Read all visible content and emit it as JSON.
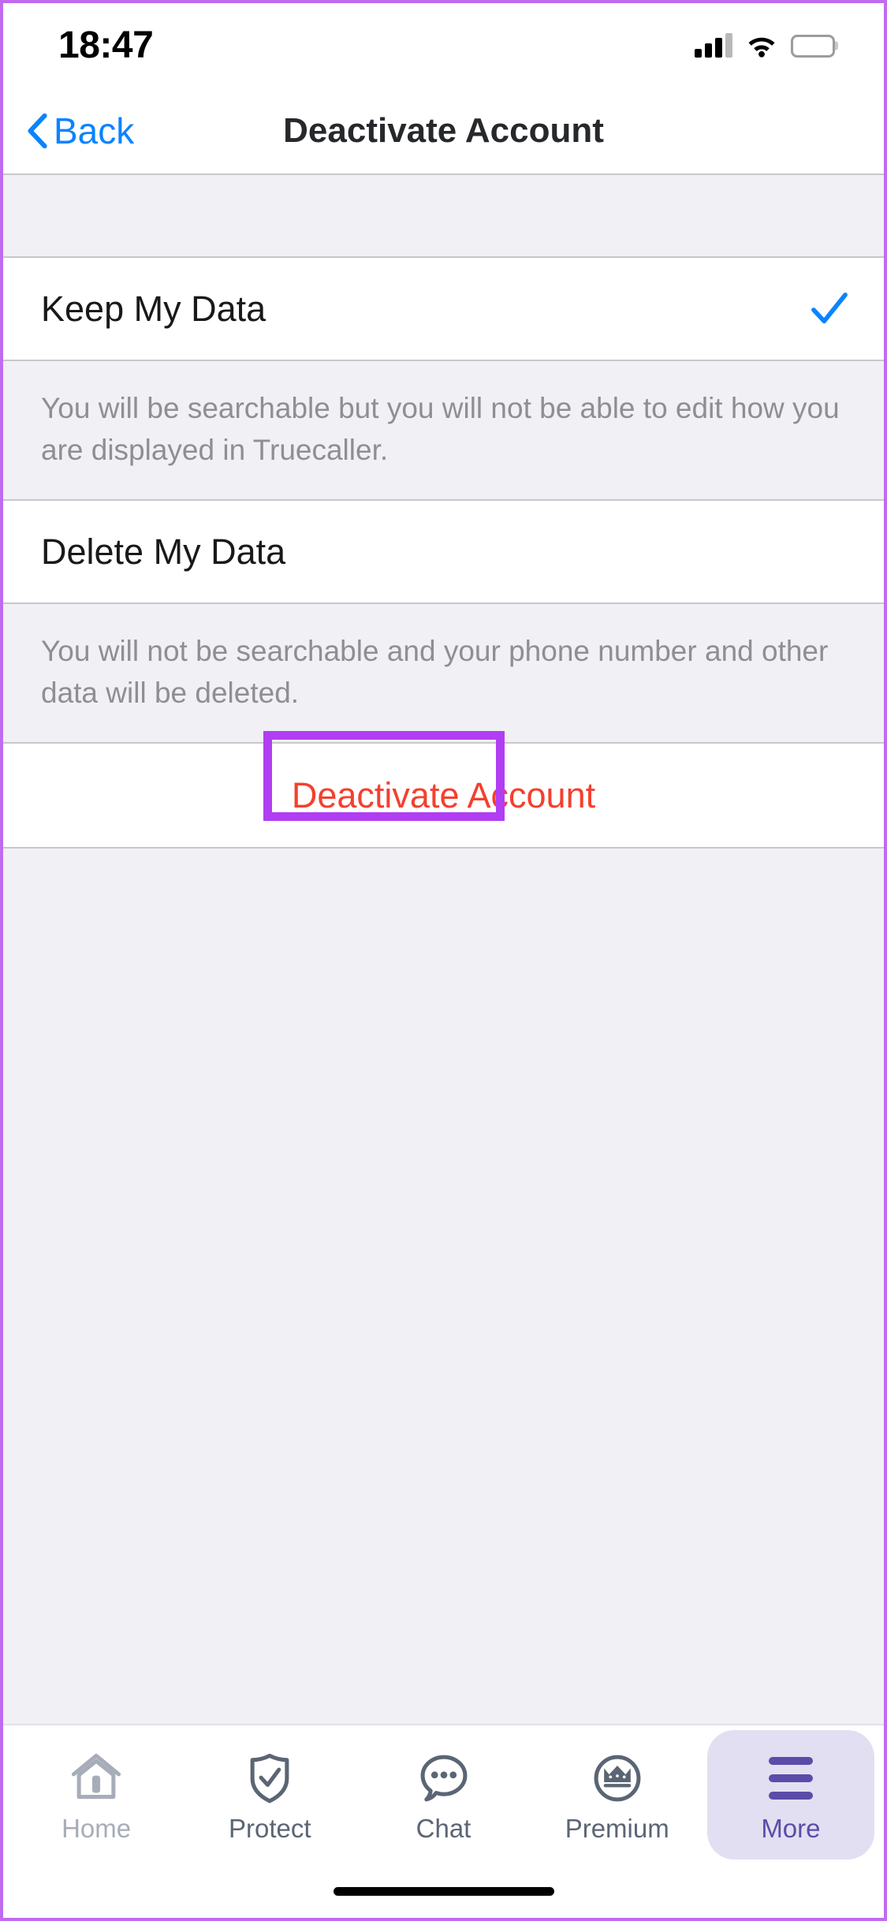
{
  "status_bar": {
    "time": "18:47",
    "signal_icon": "cellular-signal-icon",
    "wifi_icon": "wifi-icon",
    "battery_icon": "battery-icon"
  },
  "nav": {
    "back_label": "Back",
    "back_icon": "chevron-left-icon",
    "title": "Deactivate Account",
    "back_color": "#0a84ff"
  },
  "options": [
    {
      "label": "Keep My Data",
      "selected": true,
      "check_icon": "checkmark-icon",
      "description": "You will be searchable but you will not be able to edit how you are displayed in Truecaller."
    },
    {
      "label": "Delete My Data",
      "selected": false,
      "check_icon": "",
      "description": "You will not be searchable and your phone number and other data will be deleted."
    }
  ],
  "action": {
    "deactivate_label": "Deactivate Account",
    "deactivate_color": "#f4402e",
    "highlight_color": "#b13ef2"
  },
  "tabs": [
    {
      "label": "Home",
      "icon": "home-icon",
      "active": false,
      "dim": true
    },
    {
      "label": "Protect",
      "icon": "shield-check-icon",
      "active": false,
      "dim": false
    },
    {
      "label": "Chat",
      "icon": "chat-bubble-icon",
      "active": false,
      "dim": false
    },
    {
      "label": "Premium",
      "icon": "crown-circle-icon",
      "active": false,
      "dim": false
    },
    {
      "label": "More",
      "icon": "hamburger-menu-icon",
      "active": true,
      "dim": false
    }
  ],
  "theme": {
    "accent_blue": "#0a84ff",
    "destructive_red": "#f4402e",
    "active_tab_purple": "#5b4ca8",
    "active_tab_bg": "#e2dff2",
    "group_bg": "#f1f0f5",
    "separator": "#c7c7cc",
    "secondary_text": "#8e8e93"
  }
}
